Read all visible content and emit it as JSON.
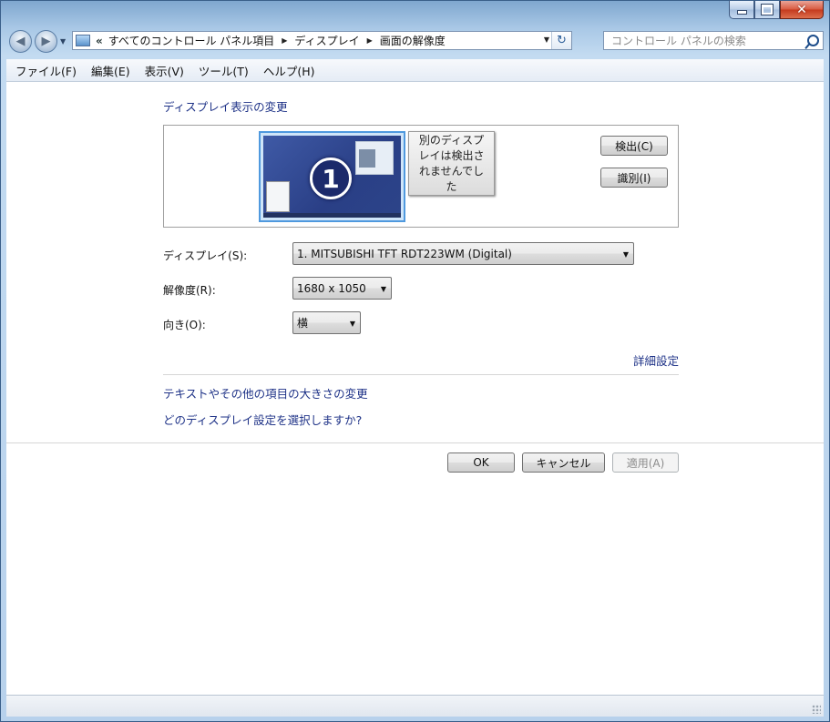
{
  "window": {
    "caption_buttons": {
      "minimize": "minimize-icon",
      "maximize": "maximize-icon",
      "close": "close-icon"
    }
  },
  "navigation": {
    "back_icon": "back-arrow-icon",
    "forward_icon": "forward-arrow-icon",
    "history_dropdown_icon": "chevron-down-icon",
    "breadcrumb": {
      "overflow": "«",
      "items": [
        "すべてのコントロール パネル項目",
        "ディスプレイ",
        "画面の解像度"
      ]
    },
    "refresh_icon": "refresh-icon"
  },
  "search": {
    "placeholder": "コントロール パネルの検索",
    "icon": "search-icon"
  },
  "menu": {
    "items": [
      "ファイル(F)",
      "編集(E)",
      "表示(V)",
      "ツール(T)",
      "ヘルプ(H)"
    ]
  },
  "main": {
    "section_title": "ディスプレイ表示の変更",
    "monitor_1_number": "1",
    "monitor_2_text": "別のディスプレイは検出されませんでした",
    "detect_button": "検出(C)",
    "identify_button": "識別(I)",
    "display_label": "ディスプレイ(S):",
    "display_value": "1. MITSUBISHI TFT RDT223WM (Digital)",
    "resolution_label": "解像度(R):",
    "resolution_value": "1680 x 1050",
    "orientation_label": "向き(O):",
    "orientation_value": "横",
    "advanced_link": "詳細設定",
    "text_size_link": "テキストやその他の項目の大きさの変更",
    "which_display_link": "どのディスプレイ設定を選択しますか?"
  },
  "buttons": {
    "ok": "OK",
    "cancel": "キャンセル",
    "apply": "適用(A)",
    "apply_enabled": false
  },
  "colors": {
    "link": "#1e3287",
    "selected_monitor_border": "#4f99de",
    "window_frame": "#a9c8e6"
  }
}
